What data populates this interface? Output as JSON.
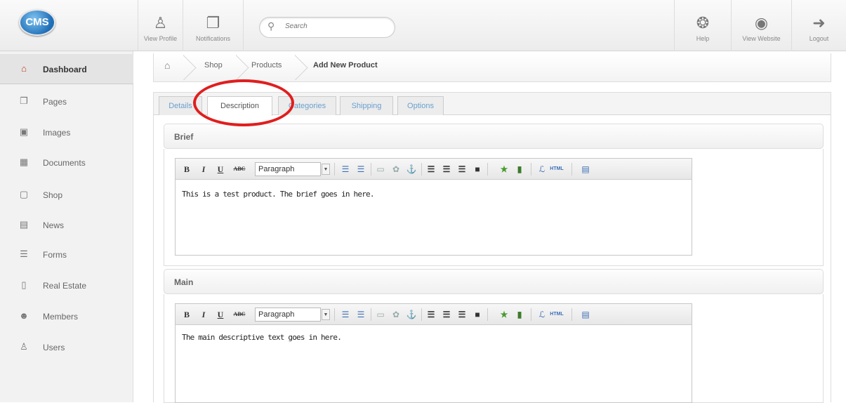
{
  "logo": {
    "text": "CMS"
  },
  "topbar": {
    "view_profile": "View Profile",
    "notifications": "Notifications",
    "search_placeholder": "Search",
    "help": "Help",
    "view_website": "View Website",
    "logout": "Logout"
  },
  "sidebar": {
    "items": [
      {
        "label": "Dashboard",
        "icon": "home-icon"
      },
      {
        "label": "Pages",
        "icon": "pages-icon"
      },
      {
        "label": "Images",
        "icon": "images-icon"
      },
      {
        "label": "Documents",
        "icon": "documents-icon"
      },
      {
        "label": "Shop",
        "icon": "cart-icon"
      },
      {
        "label": "News",
        "icon": "news-icon"
      },
      {
        "label": "Forms",
        "icon": "forms-icon"
      },
      {
        "label": "Real Estate",
        "icon": "building-icon"
      },
      {
        "label": "Members",
        "icon": "members-icon"
      },
      {
        "label": "Users",
        "icon": "user-icon"
      }
    ]
  },
  "breadcrumb": [
    "Shop",
    "Products",
    "Add New Product"
  ],
  "tabs": [
    "Details",
    "Description",
    "Categories",
    "Shipping",
    "Options"
  ],
  "active_tab": "Description",
  "sections": {
    "brief": {
      "title": "Brief",
      "text": "This is a test product. The brief goes in here."
    },
    "main": {
      "title": "Main",
      "text": "The main descriptive text goes in here."
    }
  },
  "editor": {
    "format_value": "Paragraph",
    "html_label": "HTML"
  },
  "colors": {
    "highlight_circle": "#e01e1e",
    "link": "#6aa0cf",
    "active_icon": "#c0392b"
  }
}
